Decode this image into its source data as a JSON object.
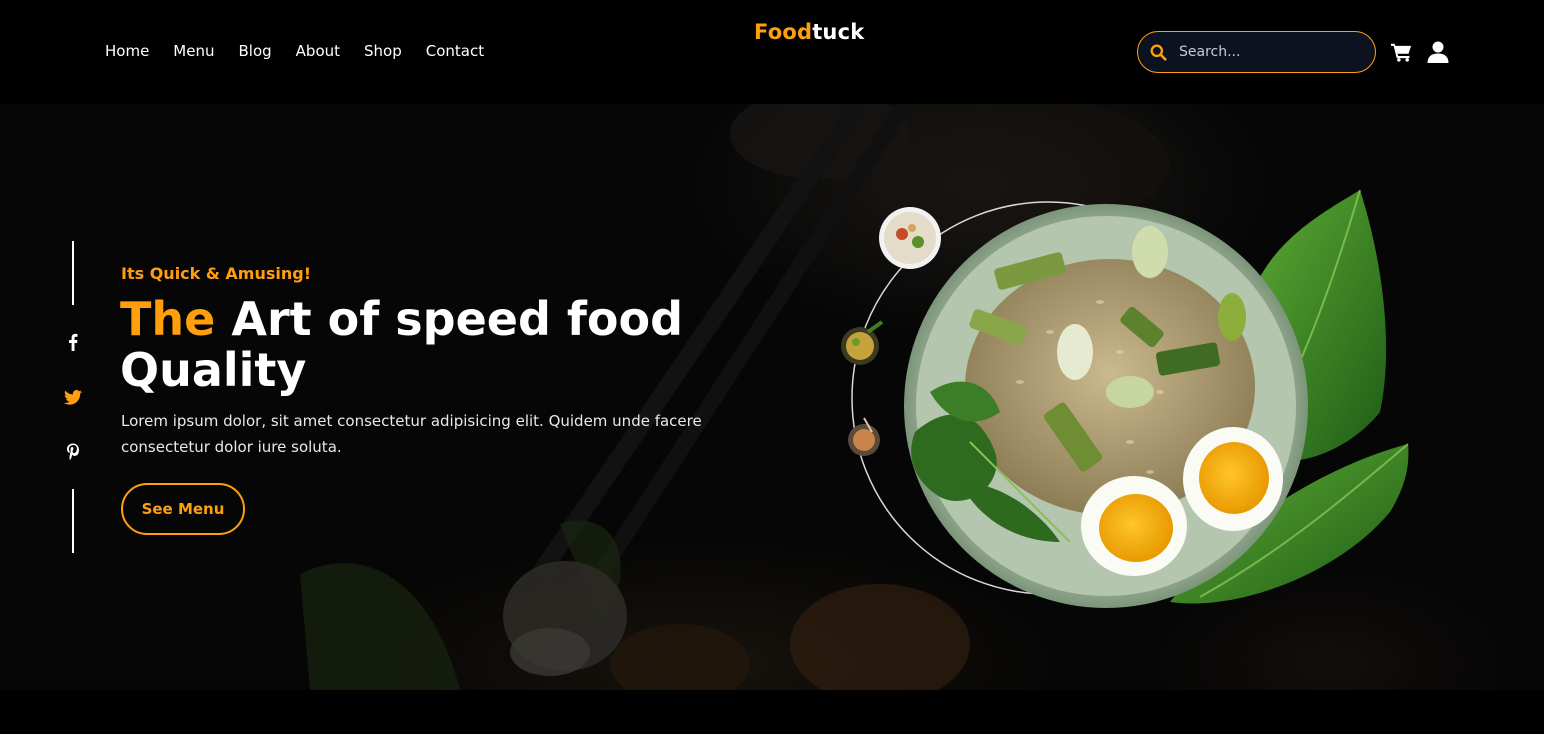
{
  "nav": {
    "links": [
      "Home",
      "Menu",
      "Blog",
      "About",
      "Shop",
      "Contact"
    ]
  },
  "logo": {
    "accent": "Food",
    "rest": "tuck"
  },
  "search": {
    "placeholder": "Search..."
  },
  "icons": {
    "search": "search-icon",
    "cart": "cart-icon",
    "user": "user-icon",
    "social": [
      "facebook-icon",
      "twitter-icon",
      "pinterest-icon"
    ]
  },
  "hero": {
    "tagline": "Its Quick & Amusing!",
    "headline_accent": "The",
    "headline_rest": "Art of speed food Quality",
    "description": "Lorem ipsum dolor, sit amet consectetur adipisicing elit. Quidem unde facere consectetur dolor iure soluta.",
    "cta_label": "See Menu"
  },
  "colors": {
    "accent": "#ff9f0d",
    "background": "#000000",
    "search_background": "#0d1220",
    "text": "#ffffff"
  }
}
